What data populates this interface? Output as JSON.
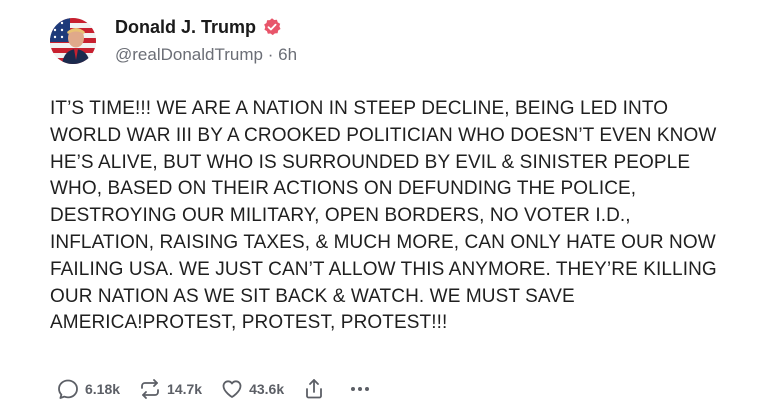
{
  "author": {
    "display_name": "Donald J. Trump",
    "handle": "@realDonaldTrump",
    "separator": "·",
    "time": "6h",
    "verified": true,
    "verified_color": "#e8556a"
  },
  "post": {
    "text": "IT’S TIME!!! WE ARE A NATION IN STEEP DECLINE, BEING LED INTO WORLD WAR III BY A CROOKED POLITICIAN WHO DOESN’T EVEN KNOW HE’S ALIVE, BUT WHO IS SURROUNDED BY EVIL & SINISTER PEOPLE WHO, BASED ON THEIR ACTIONS ON DEFUNDING THE POLICE, DESTROYING OUR MILITARY, OPEN BORDERS, NO VOTER I.D., INFLATION, RAISING TAXES, & MUCH MORE, CAN ONLY HATE OUR NOW FAILING USA. WE JUST CAN’T ALLOW THIS ANYMORE. THEY’RE  KILLING OUR NATION AS WE SIT BACK & WATCH. WE MUST SAVE AMERICA!PROTEST, PROTEST, PROTEST!!!"
  },
  "actions": {
    "replies": {
      "icon": "reply-icon",
      "count": "6.18k"
    },
    "reposts": {
      "icon": "repost-icon",
      "count": "14.7k"
    },
    "likes": {
      "icon": "heart-icon",
      "count": "43.6k"
    },
    "share": {
      "icon": "share-icon"
    },
    "more": {
      "icon": "more-icon"
    }
  },
  "colors": {
    "text": "#1f1f1f",
    "muted": "#6b6e76",
    "icon": "#5c5f66"
  }
}
